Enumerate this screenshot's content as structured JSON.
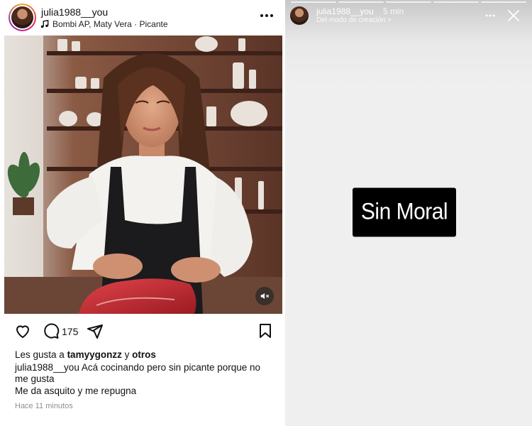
{
  "post": {
    "username": "julia1988__you",
    "audio": "Bombi AP, Maty Vera · Picante",
    "comment_count": "175",
    "likes_prefix": "Les gusta a ",
    "likes_user": "tamyygonzz",
    "likes_mid": " y ",
    "likes_others": "otros",
    "caption_user": "julia1988__you",
    "caption_text": " Acá cocinando pero sin picante porque no me gusta",
    "caption_line2": "Me da asquito y me repugna",
    "time_ago": "Hace 11 minutos",
    "icons": {
      "avatar": "avatar",
      "audio": "music-note-icon",
      "more": "more-horizontal-icon",
      "mute": "speaker-muted-icon",
      "like": "heart-icon",
      "comment": "comment-icon",
      "share": "send-icon",
      "save": "bookmark-icon"
    }
  },
  "story": {
    "username": "julia1988__you",
    "time": "5 min",
    "subtitle": "Del modo de creación >",
    "sticker_text": "Sin Moral",
    "icons": {
      "more": "more-horizontal-icon",
      "close": "close-icon"
    }
  },
  "colors": {
    "story_bg": "#efefef",
    "sticker_bg": "#000000",
    "muted_text": "#8e8e8e"
  }
}
